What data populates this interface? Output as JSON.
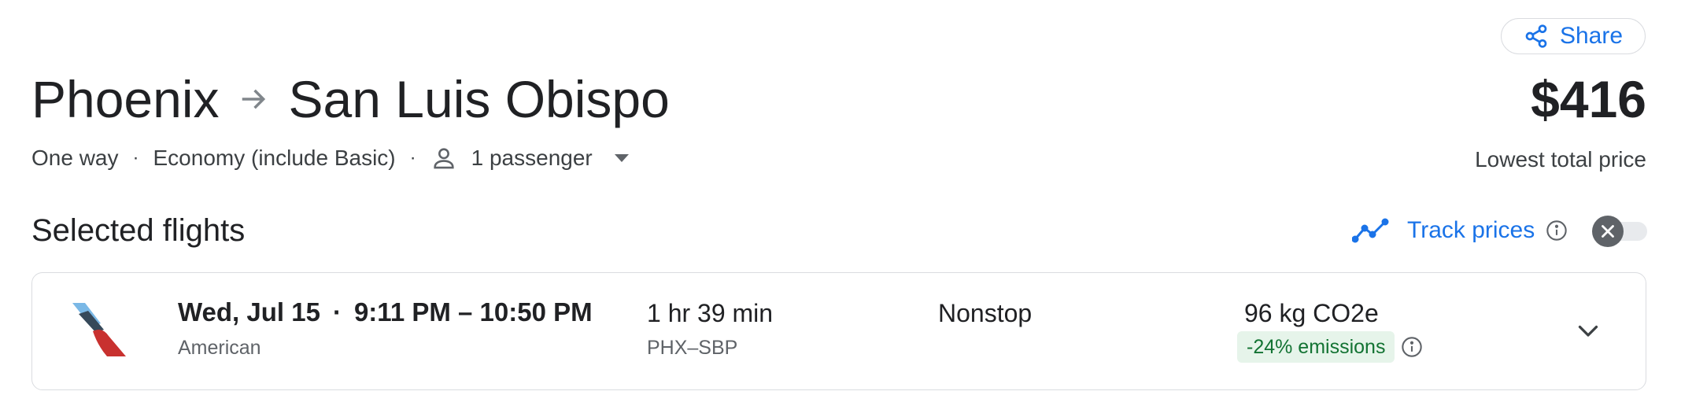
{
  "header": {
    "share_label": "Share",
    "origin": "Phoenix",
    "destination": "San Luis Obispo",
    "price": "$416",
    "price_label": "Lowest total price"
  },
  "options": {
    "trip_type": "One way",
    "cabin": "Economy (include Basic)",
    "passengers": "1 passenger",
    "separator": "·"
  },
  "selected": {
    "title": "Selected flights",
    "track_label": "Track prices",
    "track_enabled": false
  },
  "flight": {
    "date": "Wed, Jul 15",
    "separator": "·",
    "times": "9:11 PM – 10:50 PM",
    "airline": "American",
    "duration": "1 hr 39 min",
    "route": "PHX–SBP",
    "stops": "Nonstop",
    "emissions": "96 kg CO2e",
    "emissions_delta": "-24% emissions"
  },
  "icons": {
    "share": "share-icon",
    "arrow": "arrow-right-icon",
    "person": "person-icon",
    "dropdown": "caret-down-icon",
    "trend": "trend-icon",
    "info": "info-icon",
    "toggle_off": "close-icon",
    "expand": "chevron-down-icon",
    "airline_logo": "american-airlines-logo"
  },
  "colors": {
    "accent": "#1a73e8",
    "text": "#202124",
    "secondary_text": "#5f6368",
    "badge_bg": "#e6f4ea",
    "badge_text": "#137333",
    "border": "#dadce0"
  }
}
